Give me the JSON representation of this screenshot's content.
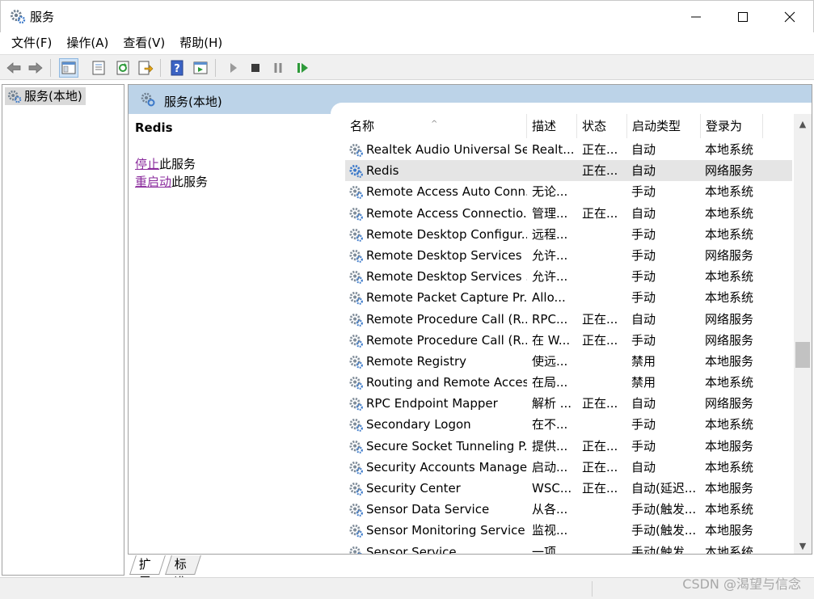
{
  "window": {
    "title": "服务"
  },
  "menu": [
    "文件(F)",
    "操作(A)",
    "查看(V)",
    "帮助(H)"
  ],
  "tree": {
    "root_label": "服务(本地)"
  },
  "pane": {
    "header_label": "服务(本地)",
    "selected_service": "Redis",
    "action_stop_link": "停止",
    "action_stop_suffix": "此服务",
    "action_restart_link": "重启动",
    "action_restart_suffix": "此服务"
  },
  "table": {
    "columns": [
      "名称",
      "描述",
      "状态",
      "启动类型",
      "登录为"
    ],
    "rows": [
      {
        "name": "Realtek Audio Universal Se...",
        "desc": "Realt...",
        "status": "正在...",
        "startup": "自动",
        "logon": "本地系统"
      },
      {
        "name": "Redis",
        "desc": "",
        "status": "正在...",
        "startup": "自动",
        "logon": "网络服务"
      },
      {
        "name": "Remote Access Auto Conn...",
        "desc": "无论...",
        "status": "",
        "startup": "手动",
        "logon": "本地系统"
      },
      {
        "name": "Remote Access Connectio...",
        "desc": "管理...",
        "status": "正在...",
        "startup": "自动",
        "logon": "本地系统"
      },
      {
        "name": "Remote Desktop Configur...",
        "desc": "远程...",
        "status": "",
        "startup": "手动",
        "logon": "本地系统"
      },
      {
        "name": "Remote Desktop Services",
        "desc": "允许...",
        "status": "",
        "startup": "手动",
        "logon": "网络服务"
      },
      {
        "name": "Remote Desktop Services ...",
        "desc": "允许...",
        "status": "",
        "startup": "手动",
        "logon": "本地系统"
      },
      {
        "name": "Remote Packet Capture Pr...",
        "desc": "Allo...",
        "status": "",
        "startup": "手动",
        "logon": "本地系统"
      },
      {
        "name": "Remote Procedure Call (R...",
        "desc": "RPC...",
        "status": "正在...",
        "startup": "自动",
        "logon": "网络服务"
      },
      {
        "name": "Remote Procedure Call (R...",
        "desc": "在 W...",
        "status": "正在...",
        "startup": "手动",
        "logon": "网络服务"
      },
      {
        "name": "Remote Registry",
        "desc": "使远...",
        "status": "",
        "startup": "禁用",
        "logon": "本地服务"
      },
      {
        "name": "Routing and Remote Access",
        "desc": "在局...",
        "status": "",
        "startup": "禁用",
        "logon": "本地系统"
      },
      {
        "name": "RPC Endpoint Mapper",
        "desc": "解析 ...",
        "status": "正在...",
        "startup": "自动",
        "logon": "网络服务"
      },
      {
        "name": "Secondary Logon",
        "desc": "在不...",
        "status": "",
        "startup": "手动",
        "logon": "本地系统"
      },
      {
        "name": "Secure Socket Tunneling P...",
        "desc": "提供...",
        "status": "正在...",
        "startup": "手动",
        "logon": "本地服务"
      },
      {
        "name": "Security Accounts Manager",
        "desc": "启动...",
        "status": "正在...",
        "startup": "自动",
        "logon": "本地系统"
      },
      {
        "name": "Security Center",
        "desc": "WSC...",
        "status": "正在...",
        "startup": "自动(延迟...",
        "logon": "本地服务"
      },
      {
        "name": "Sensor Data Service",
        "desc": "从各...",
        "status": "",
        "startup": "手动(触发...",
        "logon": "本地系统"
      },
      {
        "name": "Sensor Monitoring Service",
        "desc": "监视...",
        "status": "",
        "startup": "手动(触发...",
        "logon": "本地服务"
      },
      {
        "name": "Sensor Service",
        "desc": "一项...",
        "status": "",
        "startup": "手动(触发...",
        "logon": "本地系统"
      }
    ],
    "selected_index": 1
  },
  "tabs": [
    "扩展",
    "标准"
  ],
  "watermark": "CSDN @渴望与信念",
  "colors": {
    "pane_header": "#bcd3e8",
    "link": "#8a2a9c",
    "selected_row": "#e5e5e5",
    "gear_blue": "#3a78c9",
    "gear_gray": "#7f8c99"
  },
  "icons": {
    "app": "services-gear-icon",
    "back": "back-arrow-icon",
    "forward": "forward-arrow-icon",
    "show_hide_tree": "console-tree-icon",
    "properties": "properties-icon",
    "refresh": "refresh-icon",
    "export": "export-list-icon",
    "help": "help-icon",
    "action_pane": "action-pane-icon",
    "start": "start-service-icon",
    "stop": "stop-service-icon",
    "pause": "pause-service-icon",
    "resume": "resume-service-icon"
  }
}
